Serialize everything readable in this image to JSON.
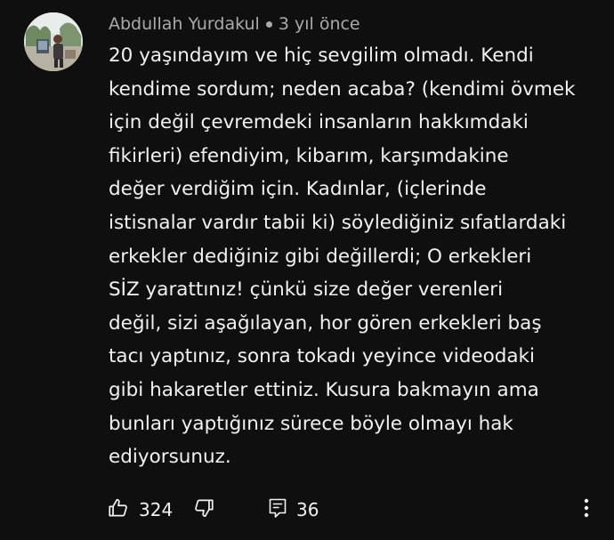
{
  "comment": {
    "author": "Abdullah Yurdakul",
    "time": "3 yıl önce",
    "text_lines": [
      "20 yaşındayım ve hiç sevgilim olmadı. Kendi",
      "kendime sordum; neden acaba? (kendimi övmek",
      "için değil çevremdeki insanların hakkımdaki",
      "fikirleri)  efendiyim, kibarım, karşımdakine",
      "değer verdiğim için. Kadınlar, (içlerinde",
      "istisnalar vardır tabii ki) söylediğiniz sıfatlardaki",
      "erkekler dediğiniz gibi değillerdi; O erkekleri",
      "SİZ yarattınız! çünkü size değer verenleri",
      "değil, sizi aşağılayan, hor gören erkekleri baş",
      "tacı yaptınız, sonra tokadı yeyince videodaki",
      "gibi hakaretler ettiniz. Kusura bakmayın ama",
      "bunları yaptığınız sürece böyle olmayı hak",
      "ediyorsunuz."
    ],
    "likes": "324",
    "replies": "36"
  },
  "icons": {
    "like": "thumbs-up-icon",
    "dislike": "thumbs-down-icon",
    "reply": "comment-icon",
    "more": "vertical-dots-icon"
  },
  "colors": {
    "background": "#0f0f0f",
    "text_primary": "#f1f1f1",
    "text_secondary": "#aaaaaa"
  }
}
